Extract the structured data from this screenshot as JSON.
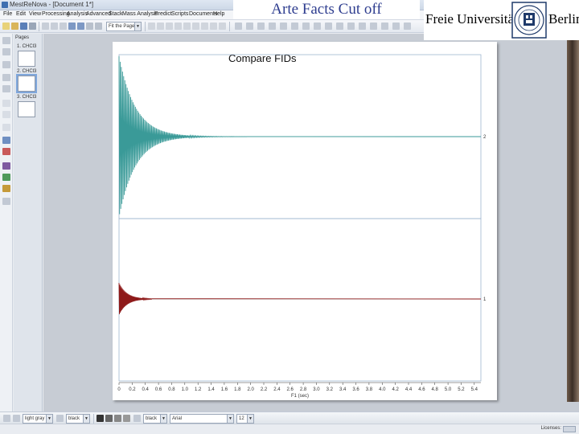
{
  "window": {
    "title": "MestReNova - [Document 1*]"
  },
  "menu": [
    "File",
    "Edit",
    "View",
    "Processing",
    "Analysis",
    "Advanced",
    "Stack",
    "Mass Analysis",
    "Predict",
    "Scripts",
    "Documents",
    "Help"
  ],
  "toolbar_top": {
    "zoom_select": "Fit the Page"
  },
  "pages_panel": {
    "title": "Pages",
    "pages": [
      {
        "label": "1. CHCl3"
      },
      {
        "label": "2. CHCl3"
      },
      {
        "label": "3. CHCl3"
      }
    ]
  },
  "toolbar_bottom": {
    "line_style_select": "light gray",
    "color_select": "black",
    "fill_select": "black",
    "font_select": "Arial",
    "size_select": "12"
  },
  "status": {
    "licenses": "Licenses:"
  },
  "slide": {
    "title": "Arte Facts Cut off",
    "logo_left": "Freie Universität",
    "logo_right": "Berlin"
  },
  "colors": {
    "fid_top": "#3a9a98",
    "fid_bottom": "#8e1a1a",
    "title": "#2e3d8f"
  },
  "chart_data": {
    "type": "line",
    "title": "Compare FIDs",
    "xlabel": "F1 (sec)",
    "x_ticks": [
      0,
      0.2,
      0.4,
      0.6,
      0.8,
      1.0,
      1.2,
      1.4,
      1.6,
      1.8,
      2.0,
      2.2,
      2.4,
      2.6,
      2.8,
      3.0,
      3.2,
      3.4,
      3.6,
      3.8,
      4.0,
      4.2,
      4.4,
      4.6,
      4.8,
      5.0,
      5.2,
      5.4
    ],
    "x_tick_labels": [
      "0",
      "0.2",
      "0.4",
      "0.6",
      "0.8",
      "1.0",
      "1.2",
      "1.4",
      "1.6",
      "1.8",
      "2.0",
      "2.2",
      "2.4",
      "2.6",
      "2.8",
      "3.0",
      "3.2",
      "3.4",
      "3.6",
      "3.8",
      "4.0",
      "4.2",
      "4.4",
      "4.6",
      "4.8",
      "5.0",
      "5.2",
      "5.4"
    ],
    "xlim": [
      0,
      5.5
    ],
    "series": [
      {
        "name": "2",
        "initial_amplitude": 1.0,
        "decay_time": 0.25,
        "end_time": 1.95,
        "points": 220
      },
      {
        "name": "1",
        "initial_amplitude": 0.2,
        "decay_time": 0.12,
        "end_time": 0.5,
        "points": 80
      }
    ]
  }
}
